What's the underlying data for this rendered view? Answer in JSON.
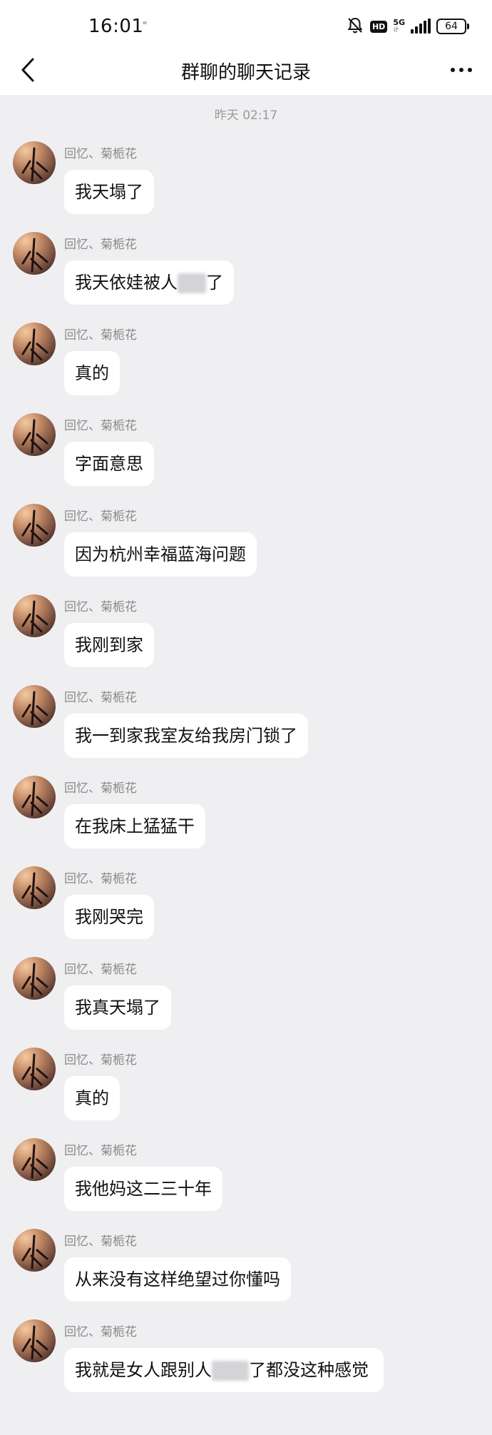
{
  "status_bar": {
    "time": "16:01",
    "hd": "HD",
    "network": "5G",
    "network_sub": "计",
    "battery": "64"
  },
  "nav": {
    "title": "群聊的聊天记录"
  },
  "timestamp": "昨天 02:17",
  "messages": [
    {
      "sender": "回忆、菊栀花",
      "text": "我天塌了"
    },
    {
      "sender": "回忆、菊栀花",
      "text_before": "我天依娃被人",
      "text_after": "了"
    },
    {
      "sender": "回忆、菊栀花",
      "text": "真的"
    },
    {
      "sender": "回忆、菊栀花",
      "text": "字面意思"
    },
    {
      "sender": "回忆、菊栀花",
      "text": "因为杭州幸福蓝海问题"
    },
    {
      "sender": "回忆、菊栀花",
      "text": "我刚到家"
    },
    {
      "sender": "回忆、菊栀花",
      "text": "我一到家我室友给我房门锁了"
    },
    {
      "sender": "回忆、菊栀花",
      "text": "在我床上猛猛干"
    },
    {
      "sender": "回忆、菊栀花",
      "text": "我刚哭完"
    },
    {
      "sender": "回忆、菊栀花",
      "text": "我真天塌了"
    },
    {
      "sender": "回忆、菊栀花",
      "text": "真的"
    },
    {
      "sender": "回忆、菊栀花",
      "text": "我他妈这二三十年"
    },
    {
      "sender": "回忆、菊栀花",
      "text": "从来没有这样绝望过你懂吗"
    },
    {
      "sender": "回忆、菊栀花",
      "text_before": "我就是女人跟别人",
      "text_after": "了都没这种感觉"
    }
  ]
}
